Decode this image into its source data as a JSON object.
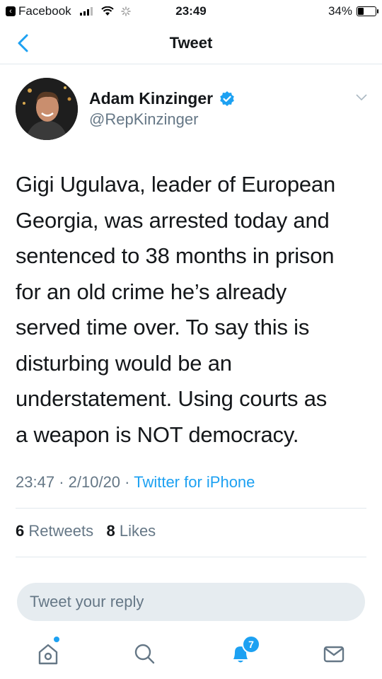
{
  "status_bar": {
    "back_app": "Facebook",
    "time": "23:49",
    "battery": "34%",
    "battery_level": 0.34
  },
  "nav": {
    "title": "Tweet"
  },
  "author": {
    "name": "Adam Kinzinger",
    "handle": "@RepKinzinger",
    "verified": true
  },
  "tweet": {
    "lines": [
      "Gigi Ugulava, leader of European",
      "Georgia, was arrested today and",
      "sentenced to 38 months in prison",
      "for an old crime he’s already",
      "served time over. To say this is",
      "disturbing would be an",
      "understatement. Using courts as",
      "a weapon is NOT democracy."
    ],
    "time": "23:47",
    "date": "2/10/20",
    "separator": "·",
    "source": "Twitter for iPhone"
  },
  "stats": {
    "retweets_count": "6",
    "retweets_label": "Retweets",
    "likes_count": "8",
    "likes_label": "Likes"
  },
  "reply": {
    "placeholder": "Tweet your reply"
  },
  "tabbar": {
    "notifications_badge": "7"
  },
  "colors": {
    "accent": "#1da1f2",
    "secondary_text": "#657786",
    "divider": "#e1e8ed"
  }
}
